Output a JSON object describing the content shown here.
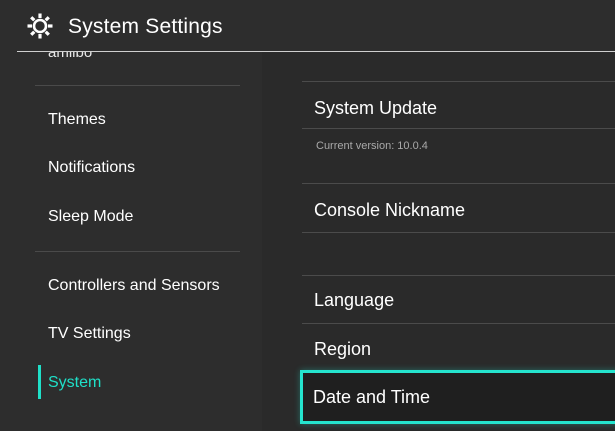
{
  "header": {
    "title": "System Settings",
    "icon": "gear-icon"
  },
  "sidebar": {
    "partial_item": "amiibo",
    "items": [
      {
        "label": "Themes"
      },
      {
        "label": "Notifications"
      },
      {
        "label": "Sleep Mode"
      },
      {
        "label": "Controllers and Sensors"
      },
      {
        "label": "TV Settings"
      },
      {
        "label": "System",
        "active": true
      }
    ],
    "accent_color": "#1fe0c8"
  },
  "main": {
    "system_update": {
      "label": "System Update",
      "subtext": "Current version: 10.0.4"
    },
    "console_nickname": {
      "label": "Console Nickname"
    },
    "language": {
      "label": "Language"
    },
    "region": {
      "label": "Region"
    },
    "date_time": {
      "label": "Date and Time",
      "selected": true
    }
  },
  "colors": {
    "background": "#2d2d2d",
    "panel": "#2a2a2a",
    "selection": "#25e4ce"
  }
}
